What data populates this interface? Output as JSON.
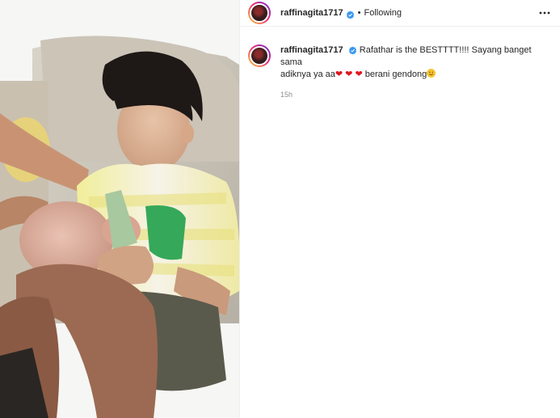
{
  "post": {
    "username": "raffinagita1717",
    "follow_status": "Following",
    "separator": "•",
    "caption_lines": [
      "Rafathar is the BESTTTT!!!! Sayang banget sama",
      "adiknya ya aa",
      "berani gendong"
    ],
    "hearts": [
      "❤",
      "❤",
      "❤"
    ],
    "timestamp": "15h"
  },
  "icons": {
    "verified": "verified-badge-icon",
    "more": "more-options-icon",
    "smile": "smiling-face-emoji-icon",
    "heart": "red-heart-emoji-icon"
  },
  "colors": {
    "text": "#262626",
    "muted": "#8e8e8e",
    "verified": "#3897f0",
    "heart": "#e0161f",
    "border": "#efefef"
  }
}
